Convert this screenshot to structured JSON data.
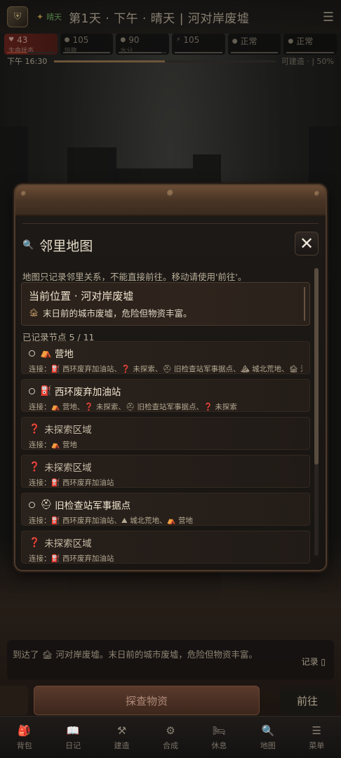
{
  "header": {
    "weather_short": "晴天",
    "title": "第1天 · 下午 · 晴天 | 河对岸废墟"
  },
  "stats": [
    {
      "value": "43",
      "label": "生命状态",
      "fill": 0.43,
      "color": "#c0503c"
    },
    {
      "value": "105",
      "label": "饱腹",
      "fill": 1.0,
      "color": "#6b665c"
    },
    {
      "value": "90",
      "label": "水分",
      "fill": 0.9,
      "color": "#6b665c"
    },
    {
      "value": "105",
      "label": "",
      "fill": 1.0,
      "color": "#6b665c"
    },
    {
      "value": "正常",
      "label": "",
      "fill": 1.0,
      "color": "#6b665c"
    },
    {
      "value": "正常",
      "label": "",
      "fill": 1.0,
      "color": "#6b665c"
    }
  ],
  "timeline": {
    "time": "下午 16:30",
    "progress": 0.5,
    "build": "可建造 · | 50%"
  },
  "modal": {
    "title": "邻里地图",
    "close": "✕",
    "note": "地图只记录邻里关系，不能直接前往。移动请使用'前往'。",
    "current_title": "当前位置 · 河对岸废墟",
    "current_desc": "末日前的城市废墟，危险但物资丰富。",
    "count": "已记录节点 5 / 11",
    "nodes": [
      {
        "icon": "⛺",
        "name": "营地",
        "unexplored": false,
        "conn": "连接：⛽ 西环废弃加油站、❓ 未探索、⛑ 旧检查站军事据点、⛰ 城北荒地、🏚 河对岸废墟"
      },
      {
        "icon": "⛽",
        "name": "西环废弃加油站",
        "unexplored": false,
        "conn": "连接：⛺ 营地、❓ 未探索、⛑ 旧检查站军事据点、❓ 未探索"
      },
      {
        "icon": "❓",
        "name": "未探索区域",
        "unexplored": true,
        "conn": "连接：⛺ 营地"
      },
      {
        "icon": "❓",
        "name": "未探索区域",
        "unexplored": true,
        "conn": "连接：⛽ 西环废弃加油站"
      },
      {
        "icon": "⛑",
        "name": "旧检查站军事据点",
        "unexplored": false,
        "conn": "连接：⛽ 西环废弃加油站、⛰ 城北荒地、⛺ 营地"
      },
      {
        "icon": "❓",
        "name": "未探索区域",
        "unexplored": true,
        "conn": "连接：⛽ 西环废弃加油站"
      }
    ]
  },
  "log": {
    "text": "到达了 🏚 河对岸废墟。末日前的城市废墟，危险但物资丰富。",
    "record": "记录 ▯"
  },
  "actions": {
    "explore": "探查物资",
    "go": "前往"
  },
  "nav": [
    {
      "icon": "🎒",
      "label": "背包"
    },
    {
      "icon": "📖",
      "label": "日记"
    },
    {
      "icon": "⚒",
      "label": "建造"
    },
    {
      "icon": "⚙",
      "label": "合成"
    },
    {
      "icon": "🛏",
      "label": "休息"
    },
    {
      "icon": "🔍",
      "label": "地图"
    },
    {
      "icon": "☰",
      "label": "菜单"
    }
  ]
}
